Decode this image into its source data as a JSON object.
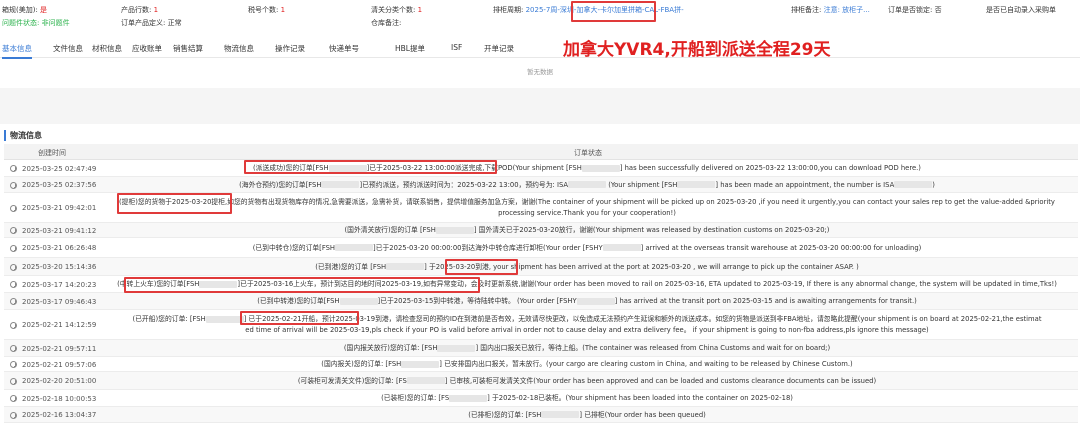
{
  "header": {
    "line1": [
      {
        "label": "箱规(美加): ",
        "value": "是",
        "color": "red"
      },
      {
        "label": "产品行数: ",
        "value": "1",
        "color": "red"
      },
      {
        "label": "税号个数: ",
        "value": "1",
        "color": "red"
      },
      {
        "label": "清关分类个数: ",
        "value": "1",
        "color": "red"
      },
      {
        "label": "排柜周期: ",
        "value": "2025-7周-深圳-加拿大-卡尔加里拼箱-CAL-FBA拼-",
        "color": "link"
      },
      {
        "label": "排柜备注: ",
        "value": "注意: 放柜子...",
        "color": "link"
      },
      {
        "label": "订单是否锁定: ",
        "value": "否",
        "color": "plain"
      },
      {
        "label": "是否已自动录入采购单",
        "value": "",
        "color": "plain"
      }
    ],
    "line2": [
      {
        "label": "问题件状态: ",
        "value": "非问题件",
        "color": "green"
      },
      {
        "label": "订单产品定义: ",
        "value": "正常",
        "color": "plain"
      },
      {
        "label": "仓库备注: ",
        "value": "",
        "color": "plain"
      }
    ]
  },
  "promo": "加拿大YVR4,开船到派送全程29天",
  "tabs": [
    "基本信息",
    "文件信息",
    "材积信息",
    "应收账单",
    "销售结算",
    "物流信息",
    "操作记录",
    "快递单号",
    "HBL提单",
    "ISF",
    "开单记录"
  ],
  "active_tab": 0,
  "empty_text": "暂无数据",
  "section_title": "物流信息",
  "columns": {
    "time": "创建时间",
    "status": "订单状态"
  },
  "rows": [
    {
      "time": "2025-03-25 02:47:49",
      "lines": [
        "(派送成功)您的订单[FSH▒▒▒▒▒▒]已于2025-03-22 13:00:00派送完成,下载POD(Your shipment [FSH▒▒▒▒▒▒] has been successfully delivered on 2025-03-22 13:00:00,you can download POD here.)"
      ]
    },
    {
      "time": "2025-03-25 02:37:56",
      "lines": [
        "(海外仓预约)您的订单[FSH▒▒▒▒▒▒]已预约派送，预约派送时间为：2025-03-22 13:00，预约号为: ISA▒▒▒▒▒ (Your shipment [FSH▒▒▒▒▒▒] has been made an appointment, the number is ISA▒▒▒▒▒)"
      ]
    },
    {
      "time": "2025-03-21 09:42:01",
      "lines": [
        "(提柜)您的货物于2025-03-20提柜,如您的货物有出现货物库存的情况,急需要派送，急需补货，请联系销售，提供增值服务加急方案，谢谢(The container of your shipment will be picked up on 2025-03-20 ,if you need it urgently,you can contact your sales rep to get the value-added &priority",
        "processing service.Thank you for your cooperation!)"
      ]
    },
    {
      "time": "2025-03-21 09:41:12",
      "lines": [
        "(国外清关放行)您的订单 [FSH▒▒▒▒▒▒] 国外清关已于2025-03-20放行，谢谢(Your shipment was released by destination customs on 2025-03-20;)"
      ]
    },
    {
      "time": "2025-03-21 06:26:48",
      "lines": [
        "(已到中转仓)您的订单[FSH▒▒▒▒▒▒]已于2025-03-20 00:00:00到达海外中转仓库进行卸柜(Your order [FSHY▒▒▒▒▒▒] arrived at the overseas transit warehouse at 2025-03-20 00:00:00 for unloading)"
      ]
    },
    {
      "time": "2025-03-20 15:14:36",
      "lines": [
        "(已到港)您的订单 [FSH▒▒▒▒▒▒] 于2025-03-20到港, your shipment has been arrived at the port at 2025-03-20 , we will arrange to pick up the container ASAP. )"
      ]
    },
    {
      "time": "2025-03-17 14:20:23",
      "lines": [
        "(中转上火车)您的订单[FSH▒▒▒▒▒▒]已于2025-03-16上火车，预计到达目的地时间2025-03-19,如有异常变动，会及时更新系统,谢谢(Your order has been moved to rail on 2025-03-16, ETA updated to 2025-03-19, If there is any abnormal change, the system will be updated in time,Tks!)"
      ]
    },
    {
      "time": "2025-03-17 09:46:43",
      "lines": [
        "(已到中转港)您的订单[FSH▒▒▒▒▒▒]已于2025-03-15到中转港，等待陆转中转。 (Your order [FSHY▒▒▒▒▒▒] has arrived at the transit port on 2025-03-15 and is awaiting arrangements for transit.)"
      ]
    },
    {
      "time": "2025-02-21 14:12:59",
      "lines": [
        "(已开船)您的订单: [FSH▒▒▒▒▒▒] 已于2025-02-21开船，预计2025-03-19到港，请检查您司的预约ID在到港前是否有效，无效请尽快更改，以免造成无法预约产生延误和额外的派送成本。如您的货物是派送到非FBA地址，请忽略此提醒(your shipment is on board at 2025-02-21,the estimat",
        "ed time of arrival will be 2025-03-19,pls check if your PO is valid before arrival in order not to cause delay and extra delivery fee。 if your shipment is going to non-fba address,pls ignore this message)"
      ]
    },
    {
      "time": "2025-02-21 09:57:11",
      "lines": [
        "(国内报关放行)您的订单: [FSH▒▒▒▒▒▒] 国内出口报关已放行，等待上船。(The container was released from China Customs and wait for on board;)"
      ]
    },
    {
      "time": "2025-02-21 09:57:06",
      "lines": [
        "(国内报关)您的订单: [FSH▒▒▒▒▒▒] 已安排国内出口报关，暂未放行。(your cargo are clearing custom in China, and waiting to be released by Chinese Custom.)"
      ]
    },
    {
      "time": "2025-02-20 20:51:00",
      "lines": [
        "(可装柜可发清关文件)您的订单: [FS▒▒▒▒▒▒] 已审核,可装柜可发清关文件(Your order has been approved and can be loaded and customs clearance documents can be issued)"
      ]
    },
    {
      "time": "2025-02-18 10:00:53",
      "lines": [
        "(已装柜)您的订单: [FS▒▒▒▒▒▒] 于2025-02-18已装柜。(Your shipment has been loaded into the container on 2025-02-18)"
      ]
    },
    {
      "time": "2025-02-16 13:04:37",
      "lines": [
        "(已排柜)您的订单: [FSH▒▒▒▒▒▒] 已排柜(Your order has been queued)"
      ]
    }
  ]
}
